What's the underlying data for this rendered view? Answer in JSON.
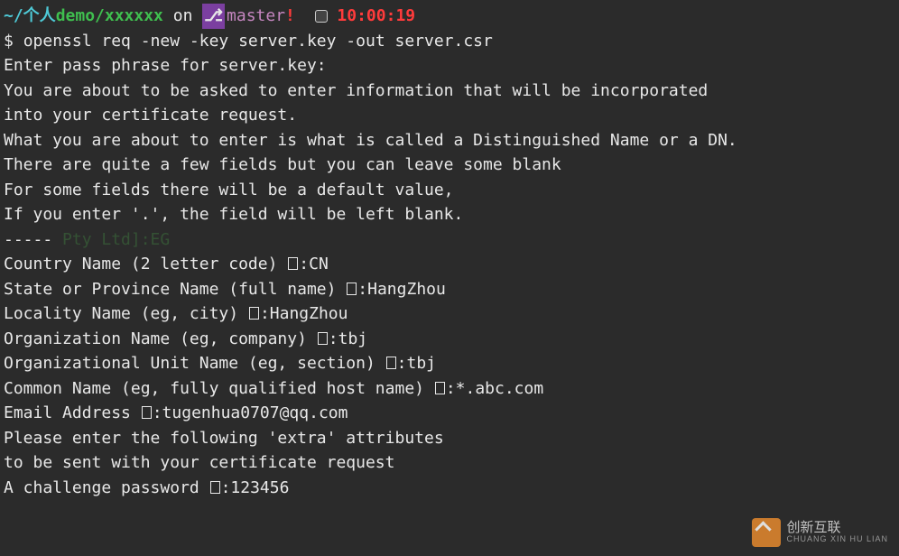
{
  "prompt": {
    "path_prefix": "~/个人",
    "path_demo": "demo/xxxxxx",
    "on": " on ",
    "branch_icon": "⎇",
    "branch": "master",
    "bang": "!",
    "time": "10:00:19"
  },
  "cmd": {
    "ps": "$ ",
    "text": "openssl req -new -key server.key -out server.csr"
  },
  "lines": {
    "l1": "Enter pass phrase for server.key:",
    "l2": "You are about to be asked to enter information that will be incorporated",
    "l3": "into your certificate request.",
    "l4": "What you are about to enter is what is called a Distinguished Name or a DN.",
    "l5": "There are quite a few fields but you can leave some blank",
    "l6": "For some fields there will be a default value,",
    "l7": "If you enter '.', the field will be left blank.",
    "l8": "-----",
    "ghost1": " Pty Ltd]:EG",
    "l9a": "Country Name (2 letter code) ",
    "l9b": ":CN",
    "l10a": "State or Province Name (full name) ",
    "l10b": ":HangZhou",
    "l11a": "Locality Name (eg, city) ",
    "l11b": ":HangZhou",
    "ghost2": "",
    "l12a": "Organization Name (eg, company) ",
    "l12b": ":tbj",
    "l13a": "Organizational Unit Name (eg, section) ",
    "l13b": ":tbj",
    "l14a": "Common Name (eg, fully qualified host name) ",
    "l14b": ":*.abc.com",
    "l15a": "Email Address ",
    "l15b": ":tugenhua0707@qq.com",
    "l16": "",
    "l17": "Please enter the following 'extra' attributes",
    "l18": "to be sent with your certificate request",
    "l19a": "A challenge password ",
    "l19b": ":123456"
  },
  "watermark": {
    "brand": "创新互联",
    "sub": "CHUANG XIN HU LIAN"
  }
}
